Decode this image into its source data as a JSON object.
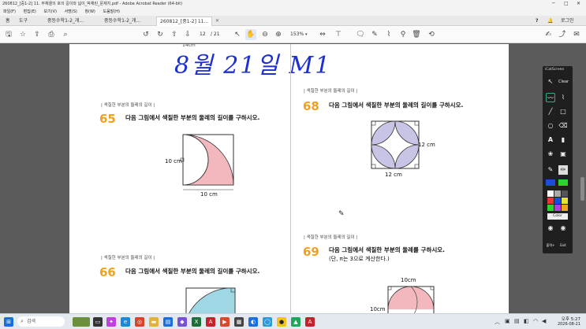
{
  "window": {
    "title": "260812_[중1-2] 11. 부채꼴의 호의 길이와 넓이_박채린_문제지.pdf - Adobe Acrobat Reader (64-bit)"
  },
  "menu": [
    "파일(F)",
    "편집(E)",
    "보기(V)",
    "서명(S)",
    "창(W)",
    "도움말(H)"
  ],
  "tabs": {
    "home": "홈",
    "tools": "도구",
    "doc1": "중등수학1-2_개...",
    "doc2": "중등수학1-2_개...",
    "doc3": "260812_[중1-2] 11..."
  },
  "header": {
    "help": "?",
    "login": "로그인"
  },
  "toolbar": {
    "page_current": "12",
    "page_total": "/ 21",
    "zoom": "153%"
  },
  "page": {
    "handwriting": "8월 21일 M1",
    "top_label": "14cm",
    "q65": {
      "category": "| 색칠한 부분의 둘레의 길이 |",
      "number": "65",
      "text": "다음 그림에서 색칠한 부분의 둘레의 길이를 구하시오.",
      "label_left": "10 cm",
      "label_bottom": "10 cm"
    },
    "q68": {
      "category": "| 색칠한 부분의 둘레의 길이 |",
      "number": "68",
      "text": "다음 그림에서 색칠한 부분의 둘레의 길이를 구하시오.",
      "label_right": "12 cm",
      "label_bottom": "12 cm"
    },
    "q66": {
      "category": "| 색칠한 부분의 둘레의 길이 |",
      "number": "66",
      "text": "다음 그림에서 색칠한 부분의 둘레의 길이를 구하시오."
    },
    "q69": {
      "category": "| 색칠한 부분의 둘레의 길이 |",
      "number": "69",
      "text": "다음 그림에서 색칠한 부분의 둘레를 구하시오.",
      "note": "(단, π는 3으로 계산한다.)",
      "label_top": "10cm",
      "label_left": "10cm"
    }
  },
  "tool_widget": {
    "title": "iCatScreen",
    "clear": "Clear",
    "color_label": "Color",
    "btn_extra": "출력+",
    "btn_exit": "Exit"
  },
  "taskbar": {
    "search": "검색",
    "time": "오후 5:27",
    "date": "2026-08-21"
  },
  "colors": {
    "accent": "#f0a11e",
    "handwriting": "#1d2fd1",
    "pink": "#f2b8bd",
    "lavender": "#c7c4e6",
    "cyan": "#9fd8e4"
  }
}
